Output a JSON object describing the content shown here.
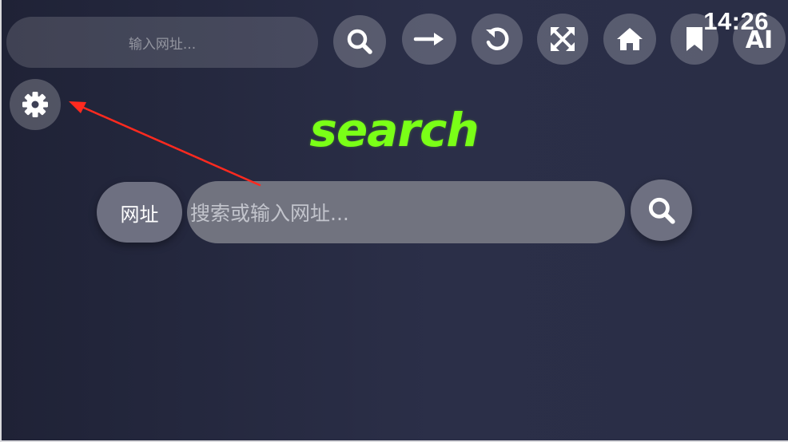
{
  "topbar": {
    "url_placeholder": "输入网址...",
    "ai_label": "AI",
    "clock": "14:26"
  },
  "main": {
    "title": "search",
    "mode_label": "网址",
    "search_placeholder": "搜索或输入网址..."
  },
  "icons": {
    "search": "search-icon",
    "go": "arrow-right-icon",
    "reload": "refresh-icon",
    "fullscreen": "fullscreen-icon",
    "home": "home-icon",
    "bookmark": "bookmark-icon",
    "settings": "gear-icon"
  },
  "colors": {
    "accent_title": "#7aff17",
    "annotation": "#ff2a1f",
    "background": "#262a40"
  }
}
